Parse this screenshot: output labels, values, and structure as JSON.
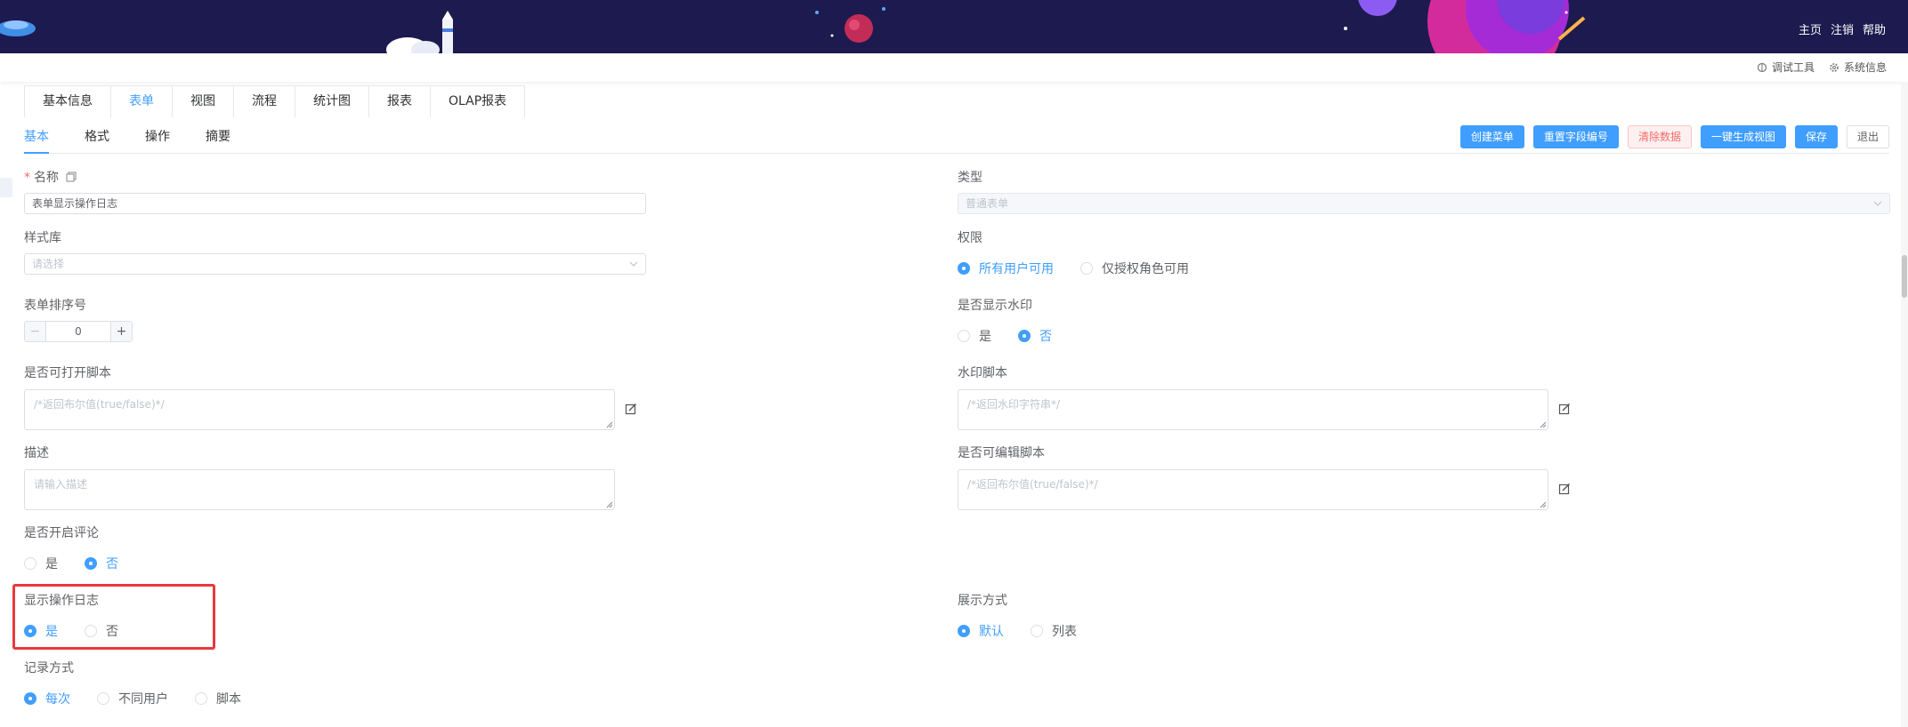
{
  "header": {
    "links": [
      "主页",
      "注销",
      "帮助"
    ]
  },
  "topbar": {
    "debug_tool": "调试工具",
    "system_info": "系统信息"
  },
  "main_tabs": [
    "基本信息",
    "表单",
    "视图",
    "流程",
    "统计图",
    "报表",
    "OLAP报表"
  ],
  "main_tab_active": "表单",
  "sub_tabs": [
    "基本",
    "格式",
    "操作",
    "摘要"
  ],
  "sub_tab_active": "基本",
  "actions": {
    "create_menu": "创建菜单",
    "reset_field_numbers": "重置字段编号",
    "clear_data": "清除数据",
    "generate_view": "一键生成视图",
    "save": "保存",
    "exit": "退出"
  },
  "form": {
    "name": {
      "label": "名称",
      "value": "表单显示操作日志"
    },
    "type": {
      "label": "类型",
      "value": "普通表单"
    },
    "style_lib": {
      "label": "样式库",
      "placeholder": "请选择"
    },
    "permission": {
      "label": "权限",
      "options": [
        "所有用户可用",
        "仅授权角色可用"
      ],
      "selected": "所有用户可用"
    },
    "sort_no": {
      "label": "表单排序号",
      "value": "0",
      "minus": "−",
      "plus": "+"
    },
    "show_watermark": {
      "label": "是否显示水印",
      "options": [
        "是",
        "否"
      ],
      "selected": "否"
    },
    "open_script": {
      "label": "是否可打开脚本",
      "placeholder": "/*返回布尔值(true/false)*/"
    },
    "watermark_script": {
      "label": "水印脚本",
      "placeholder": "/*返回水印字符串*/"
    },
    "description": {
      "label": "描述",
      "placeholder": "请输入描述"
    },
    "edit_script": {
      "label": "是否可编辑脚本",
      "placeholder": "/*返回布尔值(true/false)*/"
    },
    "enable_comment": {
      "label": "是否开启评论",
      "options": [
        "是",
        "否"
      ],
      "selected": "否"
    },
    "show_log": {
      "label": "显示操作日志",
      "options": [
        "是",
        "否"
      ],
      "selected": "是"
    },
    "display_mode": {
      "label": "展示方式",
      "options": [
        "默认",
        "列表"
      ],
      "selected": "默认"
    },
    "record_mode": {
      "label": "记录方式",
      "options": [
        "每次",
        "不同用户",
        "脚本"
      ],
      "selected": "每次"
    }
  },
  "colors": {
    "primary": "#409eff",
    "banner": "#1c1a4e",
    "highlight": "#e8393e"
  }
}
